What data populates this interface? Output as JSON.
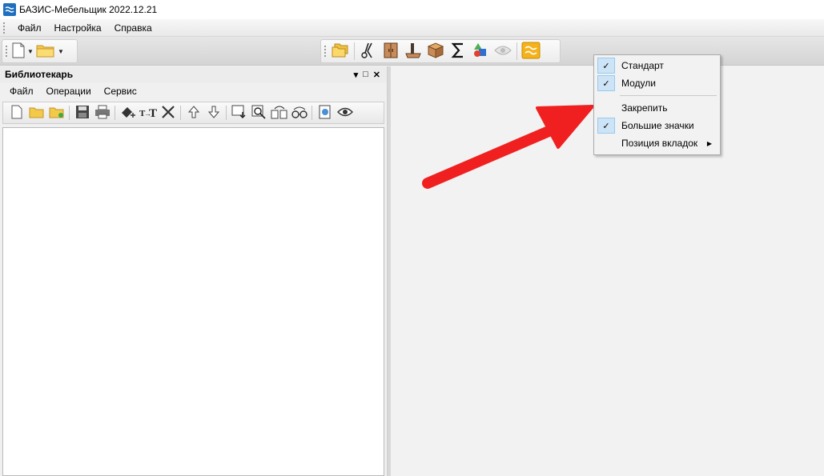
{
  "window": {
    "title": "БАЗИС-Мебельщик 2022.12.21"
  },
  "menubar": {
    "items": [
      "Файл",
      "Настройка",
      "Справка"
    ]
  },
  "library": {
    "title": "Библиотекарь",
    "controls": [
      "▾",
      "□",
      "✕"
    ],
    "menu": [
      "Файл",
      "Операции",
      "Сервис"
    ]
  },
  "context_menu": {
    "items": [
      {
        "label": "Стандарт",
        "checked": true
      },
      {
        "label": "Модули",
        "checked": true
      },
      {
        "label": "Закрепить",
        "checked": false
      },
      {
        "label": "Большие значки",
        "checked": true
      },
      {
        "label": "Позиция вкладок",
        "checked": false,
        "submenu": true
      }
    ],
    "check_glyph": "✓",
    "submenu_glyph": "▶"
  },
  "colors": {
    "annotation_arrow": "#f02020",
    "check_highlight": "#cde4f7",
    "app_icon": "#1e6fc0"
  }
}
